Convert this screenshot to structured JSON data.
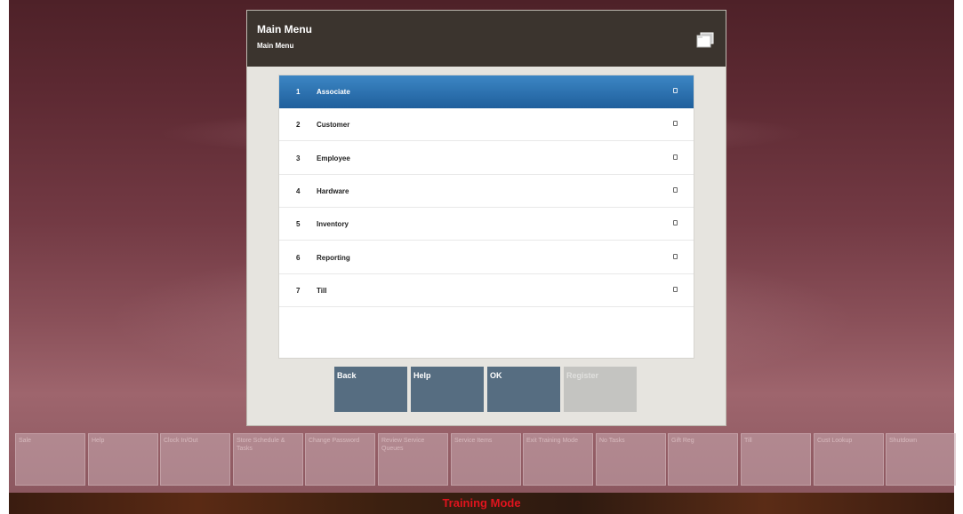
{
  "dialog": {
    "title": "Main Menu",
    "subtitle": "Main Menu",
    "header_icon": "folders-icon"
  },
  "menu": {
    "items": [
      {
        "number": "1",
        "label": "Associate",
        "selected": true
      },
      {
        "number": "2",
        "label": "Customer",
        "selected": false
      },
      {
        "number": "3",
        "label": "Employee",
        "selected": false
      },
      {
        "number": "4",
        "label": "Hardware",
        "selected": false
      },
      {
        "number": "5",
        "label": "Inventory",
        "selected": false
      },
      {
        "number": "6",
        "label": "Reporting",
        "selected": false
      },
      {
        "number": "7",
        "label": "Till",
        "selected": false
      }
    ],
    "item_icon": "submenu-icon"
  },
  "buttons": {
    "back": "Back",
    "help": "Help",
    "ok": "OK",
    "register": "Register"
  },
  "function_bar": [
    {
      "label": "Sale"
    },
    {
      "label": "Help"
    },
    {
      "label": "Clock In/Out"
    },
    {
      "label": "Store Schedule & Tasks"
    },
    {
      "label": "Change Password"
    },
    {
      "label": "Review Service Queues"
    },
    {
      "label": "Service Items"
    },
    {
      "label": "Exit Training Mode"
    },
    {
      "label": "No Tasks"
    },
    {
      "label": "Gift Reg"
    },
    {
      "label": "Till"
    },
    {
      "label": "Cust Lookup"
    },
    {
      "label": "Shutdown"
    }
  ],
  "status_bar": {
    "mode": "Training Mode"
  },
  "colors": {
    "header": "#3b342e",
    "selected": "#2a6fae",
    "button": "#566d81",
    "disabled_button": "#c4c4c1",
    "training_mode_text": "#e0141e"
  }
}
